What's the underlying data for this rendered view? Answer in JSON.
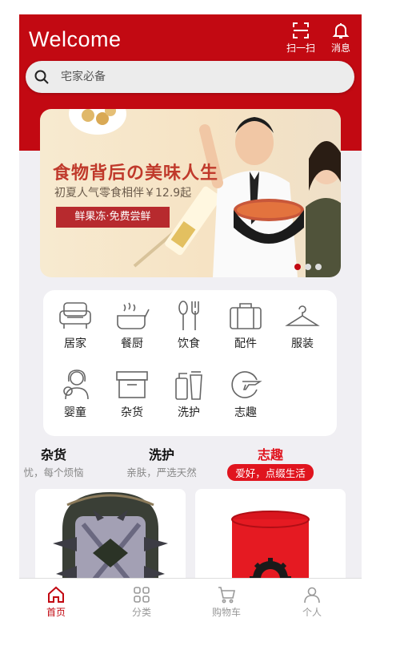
{
  "header": {
    "title": "Welcome",
    "scan_label": "扫一扫",
    "message_label": "消息",
    "brand_color": "#c20912"
  },
  "search": {
    "placeholder": "宅家必备"
  },
  "banner": {
    "headline": "食物背后の美味人生",
    "subline": "初夏人气零食相伴￥12.9起",
    "cta": "鲜果冻·免费尝鲜",
    "slide_count": 3,
    "active_slide": 1
  },
  "categories": [
    {
      "label": "居家",
      "icon": "sofa-icon"
    },
    {
      "label": "餐厨",
      "icon": "cookware-icon"
    },
    {
      "label": "饮食",
      "icon": "utensils-icon"
    },
    {
      "label": "配件",
      "icon": "briefcase-icon"
    },
    {
      "label": "服装",
      "icon": "hanger-icon"
    },
    {
      "label": "婴童",
      "icon": "mother-baby-icon"
    },
    {
      "label": "杂货",
      "icon": "storage-box-icon"
    },
    {
      "label": "洗护",
      "icon": "toiletries-icon"
    },
    {
      "label": "志趣",
      "icon": "globe-plane-icon"
    }
  ],
  "tabs": [
    {
      "title": "杂货",
      "subtitle": "忧，每个烦恼"
    },
    {
      "title": "洗护",
      "subtitle": "亲肤，严选天然"
    },
    {
      "title": "志趣",
      "subtitle": "爱好，点缀生活",
      "active": true
    }
  ],
  "products": [
    {
      "name": "spiked-backpack",
      "icon": "backpack-icon"
    },
    {
      "name": "red-wristband",
      "icon": "wristband-icon"
    }
  ],
  "bottom_nav": [
    {
      "label": "首页",
      "icon": "home-icon",
      "active": true
    },
    {
      "label": "分类",
      "icon": "category-grid-icon"
    },
    {
      "label": "购物车",
      "icon": "cart-icon"
    },
    {
      "label": "个人",
      "icon": "user-icon"
    }
  ]
}
